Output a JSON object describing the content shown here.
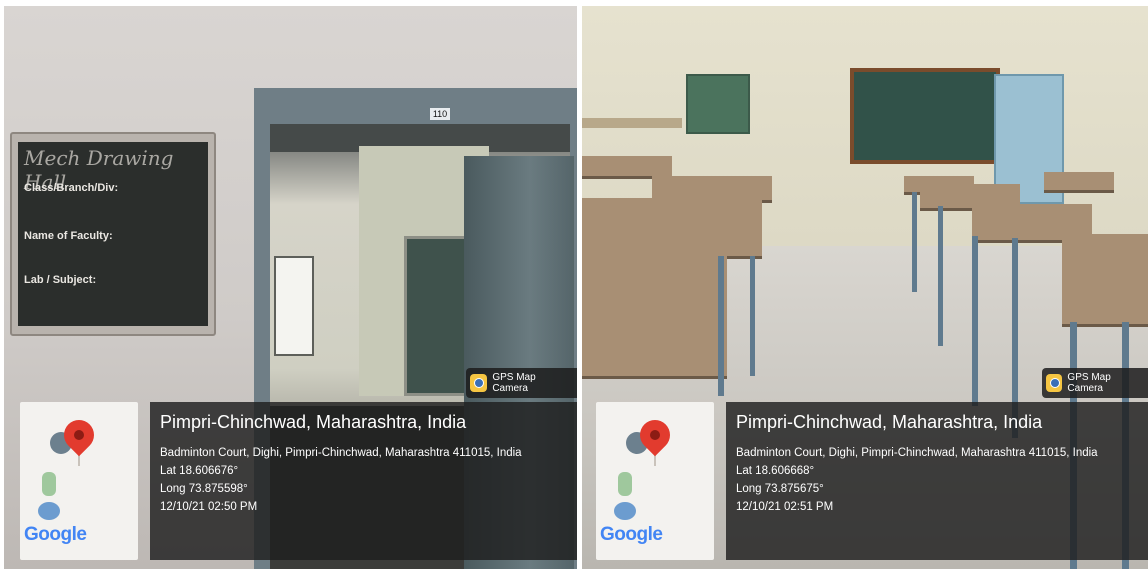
{
  "left_photo": {
    "room_number": "110",
    "board": {
      "heading": "Mech Drawing Hall",
      "labels": [
        "Class/Branch/Div:",
        "Name of Faculty:",
        "Lab / Subject:"
      ]
    },
    "gps_tag": "GPS Map Camera",
    "map_logo": "Google",
    "location": {
      "title": "Pimpri-Chinchwad, Maharashtra, India",
      "address": "Badminton Court, Dighi, Pimpri-Chinchwad, Maharashtra 411015, India",
      "lat": "Lat 18.606676°",
      "long": "Long 73.875598°",
      "datetime": "12/10/21 02:50 PM"
    }
  },
  "right_photo": {
    "gps_tag": "GPS Map Camera",
    "map_logo": "Google",
    "location": {
      "title": "Pimpri-Chinchwad, Maharashtra, India",
      "address": "Badminton Court, Dighi, Pimpri-Chinchwad, Maharashtra 411015, India",
      "lat": "Lat 18.606668°",
      "long": "Long 73.875675°",
      "datetime": "12/10/21 02:51 PM"
    }
  },
  "colors": {
    "overlay_bg": "#1e1e1e",
    "pin_red": "#e23b2e",
    "chalkboard_green": "#315249"
  }
}
